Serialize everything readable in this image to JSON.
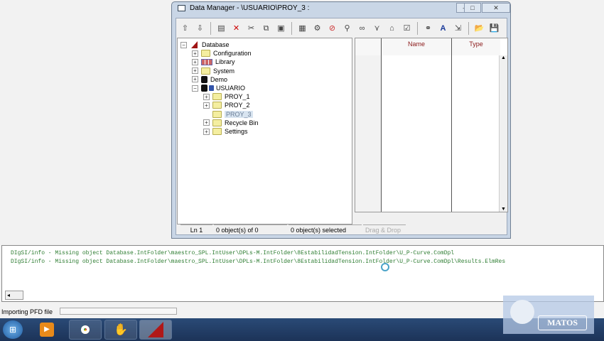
{
  "window": {
    "title": "Data Manager - \\USUARIO\\PROY_3 :",
    "minimize": "–",
    "maximize": "□",
    "close": "✕"
  },
  "toolbar": [
    {
      "icon": "folder-up-icon",
      "g": "⇧"
    },
    {
      "icon": "folder-down-icon",
      "g": "⇩"
    },
    {
      "sep": true
    },
    {
      "icon": "new-object-icon",
      "g": "▤"
    },
    {
      "icon": "delete-icon",
      "g": "✕"
    },
    {
      "icon": "cut-icon",
      "g": "✂"
    },
    {
      "icon": "copy-icon",
      "g": "⧉"
    },
    {
      "icon": "paste-icon",
      "g": "▣"
    },
    {
      "sep": true
    },
    {
      "icon": "edit-object-icon",
      "g": "▦"
    },
    {
      "icon": "gear-icon",
      "g": "⚙"
    },
    {
      "icon": "forbidden-icon",
      "g": "⊘"
    },
    {
      "icon": "inspect-icon",
      "g": "⚲"
    },
    {
      "icon": "glasses-icon",
      "g": "∞"
    },
    {
      "icon": "filter-icon",
      "g": "⋎"
    },
    {
      "icon": "network-icon",
      "g": "⌂"
    },
    {
      "icon": "checklist-icon",
      "g": "☑"
    },
    {
      "sep": true
    },
    {
      "icon": "binoculars-icon",
      "g": "⚭"
    },
    {
      "icon": "font-icon",
      "g": "A"
    },
    {
      "icon": "export-icon",
      "g": "⇲"
    },
    {
      "sep": true
    },
    {
      "icon": "open-folder-icon",
      "g": "📂"
    },
    {
      "icon": "save-icon",
      "g": "💾"
    }
  ],
  "tree": [
    {
      "label": "Database",
      "level": 0,
      "pm": "−",
      "icon": "database"
    },
    {
      "label": "Configuration",
      "level": 1,
      "pm": "+",
      "icon": "folder"
    },
    {
      "label": "Library",
      "level": 1,
      "pm": "+",
      "icon": "library"
    },
    {
      "label": "System",
      "level": 1,
      "pm": "+",
      "icon": "folder"
    },
    {
      "label": "Demo",
      "level": 1,
      "pm": "+",
      "icon": "user"
    },
    {
      "label": "USUARIO",
      "level": 1,
      "pm": "−",
      "icon": "user"
    },
    {
      "label": "PROY_1",
      "level": 2,
      "pm": "+",
      "icon": "folder"
    },
    {
      "label": "PROY_2",
      "level": 2,
      "pm": "+",
      "icon": "folder"
    },
    {
      "label": "PROY_3",
      "level": 2,
      "pm": "",
      "icon": "folder",
      "selected": true
    },
    {
      "label": "Recycle Bin",
      "level": 2,
      "pm": "+",
      "icon": "folder"
    },
    {
      "label": "Settings",
      "level": 2,
      "pm": "+",
      "icon": "folder"
    }
  ],
  "list": {
    "columns": [
      "",
      "Name",
      "Type"
    ]
  },
  "status": {
    "line": "Ln 1",
    "objects": "0 object(s) of 0",
    "selected": "0 object(s) selected",
    "dragdrop": "Drag & Drop"
  },
  "output": {
    "lines": [
      "DIgSI/info - Missing object Database.IntFolder\\maestro_SPL.IntUser\\DPLs-M.IntFolder\\8EstabilidadTension.IntFolder\\U_P-Curve.ComDpl",
      "DIgSI/info - Missing object Database.IntFolder\\maestro_SPL.IntUser\\DPLs-M.IntFolder\\8EstabilidadTension.IntFolder\\U_P-Curve.ComDpl\\Results.ElmRes"
    ]
  },
  "statusbar": {
    "text": "Importing PFD file"
  },
  "taskbar": [
    "start-button",
    "media-player",
    "chrome",
    "app-glove",
    "powerfactory"
  ],
  "watermark": "MATOS",
  "colors": {
    "header_text": "#8b1a1a",
    "log_text": "#2e7d32",
    "taskbar": "#1c3358"
  }
}
